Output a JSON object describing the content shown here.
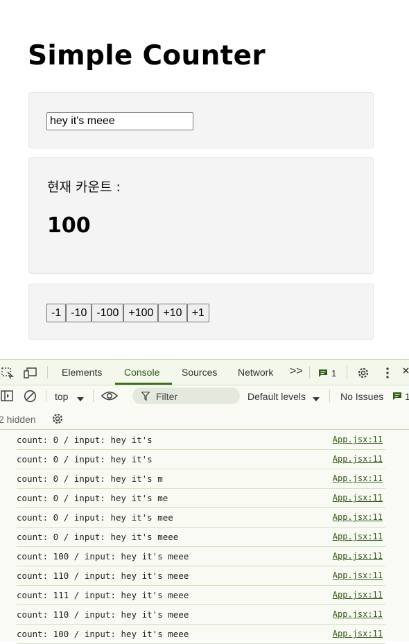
{
  "app": {
    "title": "Simple Counter",
    "input_value": "hey it's meee",
    "count_label": "현재 카운트 :",
    "count_value": "100",
    "buttons": [
      "-1",
      "-10",
      "-100",
      "+100",
      "+10",
      "+1"
    ]
  },
  "devtools": {
    "tabs": [
      "Elements",
      "Console",
      "Sources",
      "Network"
    ],
    "active_tab": "Console",
    "more_tabs_glyph": ">>",
    "message_count": "1",
    "context": "top",
    "filter_placeholder": "Filter",
    "default_levels": "Default levels",
    "no_issues": "No Issues",
    "issues_count": "1",
    "hidden": "2 hidden",
    "logs": [
      {
        "msg": "count: 0 / input: hey it's",
        "src": "App.jsx:11"
      },
      {
        "msg": "count: 0 / input: hey it's ",
        "src": "App.jsx:11"
      },
      {
        "msg": "count: 0 / input: hey it's m",
        "src": "App.jsx:11"
      },
      {
        "msg": "count: 0 / input: hey it's me",
        "src": "App.jsx:11"
      },
      {
        "msg": "count: 0 / input: hey it's mee",
        "src": "App.jsx:11"
      },
      {
        "msg": "count: 0 / input: hey it's meee",
        "src": "App.jsx:11"
      },
      {
        "msg": "count: 100 / input: hey it's meee",
        "src": "App.jsx:11"
      },
      {
        "msg": "count: 110 / input: hey it's meee",
        "src": "App.jsx:11"
      },
      {
        "msg": "count: 111 / input: hey it's meee",
        "src": "App.jsx:11"
      },
      {
        "msg": "count: 110 / input: hey it's meee",
        "src": "App.jsx:11"
      },
      {
        "msg": "count: 100 / input: hey it's meee",
        "src": "App.jsx:11"
      }
    ],
    "colors": {
      "accent": "#3d6f1d",
      "background": "#f8faf3",
      "link": "#2f5a16"
    }
  }
}
